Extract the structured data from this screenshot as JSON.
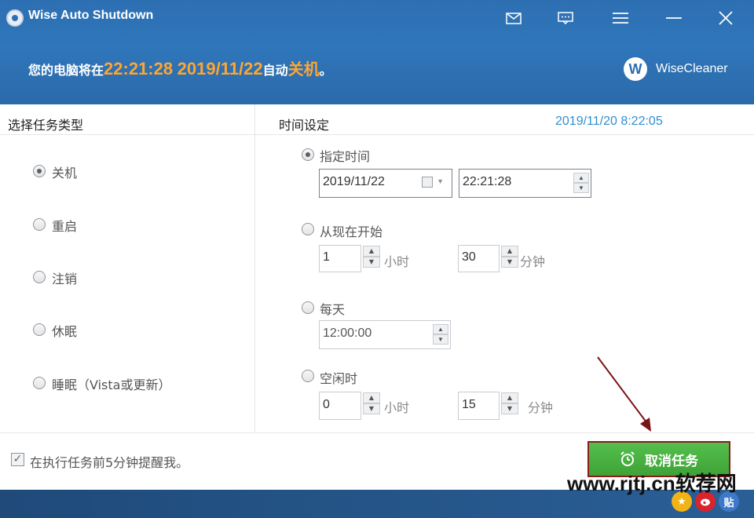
{
  "window": {
    "title": "Wise Auto Shutdown"
  },
  "status": {
    "prefix": "您的电脑将在",
    "time": "22:21:28",
    "date": "2019/11/22",
    "middle": "自动",
    "action": "关机",
    "suffix": "。"
  },
  "brand": {
    "logo_letter": "W",
    "name": "WiseCleaner"
  },
  "left_panel": {
    "header": "选择任务类型",
    "options": [
      {
        "label": "关机",
        "selected": true
      },
      {
        "label": "重启",
        "selected": false
      },
      {
        "label": "注销",
        "selected": false
      },
      {
        "label": "休眠",
        "selected": false
      },
      {
        "label": "睡眠（Vista或更新）",
        "selected": false
      }
    ]
  },
  "right_panel": {
    "header": "时间设定",
    "current_datetime": "2019/11/20 8:22:05",
    "specified": {
      "label": "指定时间",
      "selected": true,
      "date_value": "2019/11/22",
      "time_value": "22:21:28"
    },
    "from_now": {
      "label": "从现在开始",
      "hours_value": "1",
      "hours_unit": "小时",
      "minutes_value": "30",
      "minutes_unit": "分钟"
    },
    "daily": {
      "label": "每天",
      "time_value": "12:00:00"
    },
    "idle": {
      "label": "空闲时",
      "hours_value": "0",
      "hours_unit": "小时",
      "minutes_value": "15",
      "minutes_unit": "分钟"
    }
  },
  "footer": {
    "reminder_label": "在执行任务前5分钟提醒我。",
    "reminder_checked": true,
    "cancel_button": "取消任务"
  },
  "watermark": "www.rjtj.cn软荐网",
  "social": {
    "weibo_label": "贴"
  },
  "colors": {
    "header_blue": "#2d6fb2",
    "highlight_orange": "#ffa531",
    "button_green": "#4cb244",
    "date_blue": "#2f8fd1"
  }
}
